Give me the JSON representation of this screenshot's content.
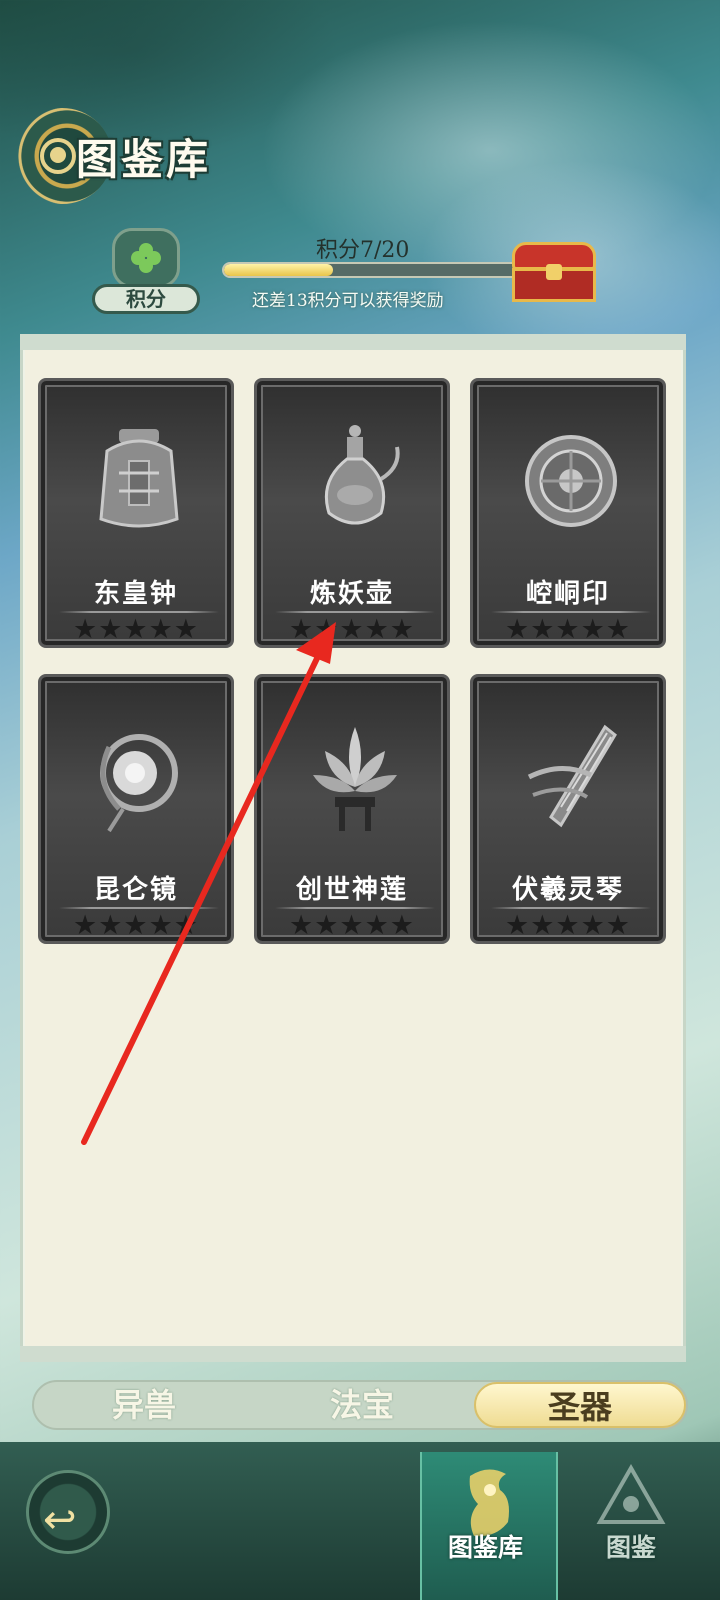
{
  "page": {
    "title": "图鉴库"
  },
  "points": {
    "badge_label": "积分",
    "score_text": "积分7/20",
    "current": 7,
    "total": 20,
    "hint": "还差13积分可以获得奖励"
  },
  "cards": [
    {
      "name": "东皇钟",
      "stars": "★★★★★"
    },
    {
      "name": "炼妖壶",
      "stars": "★★★★★"
    },
    {
      "name": "崆峒印",
      "stars": "★★★★★"
    },
    {
      "name": "昆仑镜",
      "stars": "★★★★★"
    },
    {
      "name": "创世神莲",
      "stars": "★★★★★"
    },
    {
      "name": "伏羲灵琴",
      "stars": "★★★★★"
    }
  ],
  "tabs": [
    {
      "label": "异兽",
      "active": false
    },
    {
      "label": "法宝",
      "active": false
    },
    {
      "label": "圣器",
      "active": true
    }
  ],
  "bottom_nav": [
    {
      "label": "图鉴库",
      "active": true
    },
    {
      "label": "图鉴",
      "active": false
    }
  ],
  "colors": {
    "accent_gold": "#efdc93",
    "panel_bg": "#f2f0e0",
    "card_bg": "#3a3a3a",
    "progress_fill": "#e9c54a",
    "annotation_red": "#e8281f"
  }
}
